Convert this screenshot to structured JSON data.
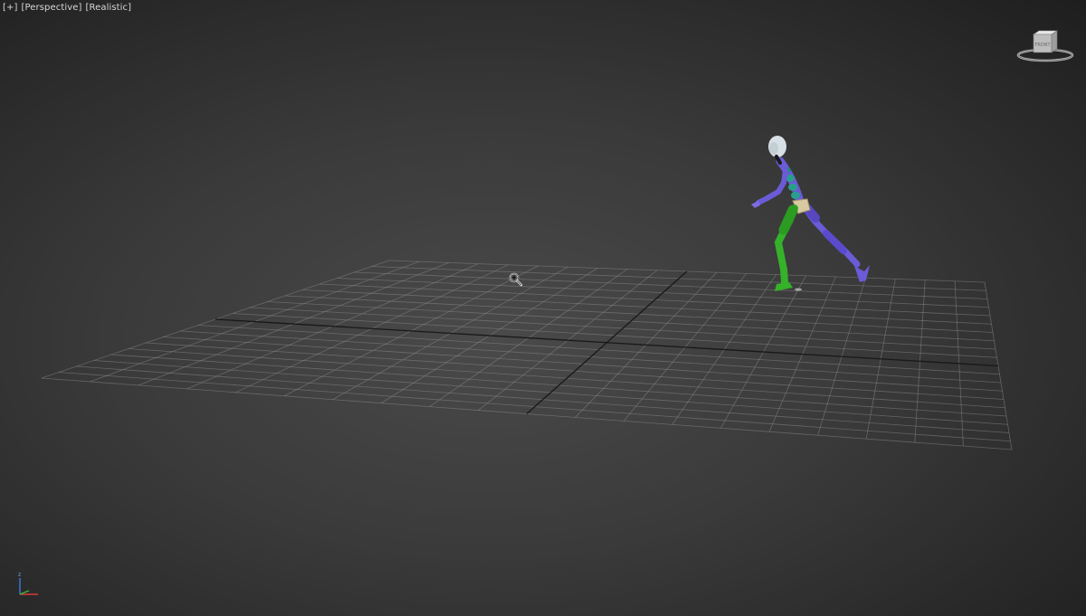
{
  "viewport": {
    "label_items": [
      "[+]",
      "[Perspective]",
      "[Realistic]"
    ],
    "viewcube_face": "FRONT",
    "axis_labels": {
      "x": "x",
      "y": "y",
      "z": "z"
    }
  },
  "icons": {
    "viewcube": "viewcube-icon",
    "axis_tripod": "axis-tripod-icon",
    "zoom_cursor": "zoom-cursor-icon"
  },
  "colors": {
    "grid_line": "#8a8a8a",
    "grid_axis": "#111111",
    "bone_upper": "#6a5bd6",
    "bone_leg": "#35b12a",
    "bone_spine": "#2a9e8e",
    "head": "#d8e0e6"
  }
}
